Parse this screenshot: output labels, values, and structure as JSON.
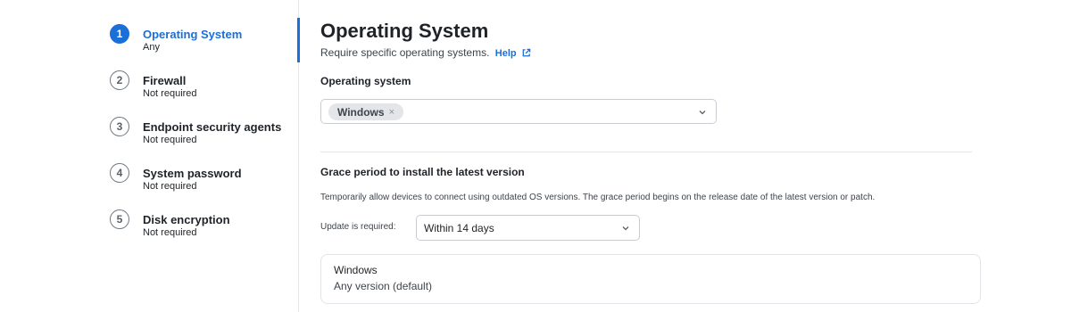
{
  "stepper": {
    "steps": [
      {
        "num": "1",
        "title": "Operating System",
        "subtitle": "Any"
      },
      {
        "num": "2",
        "title": "Firewall",
        "subtitle": "Not required"
      },
      {
        "num": "3",
        "title": "Endpoint security agents",
        "subtitle": "Not required"
      },
      {
        "num": "4",
        "title": "System password",
        "subtitle": "Not required"
      },
      {
        "num": "5",
        "title": "Disk encryption",
        "subtitle": "Not required"
      }
    ],
    "active_index": 0
  },
  "main": {
    "title": "Operating System",
    "description": "Require specific operating systems.",
    "help_label": "Help",
    "os_field": {
      "label": "Operating system",
      "selected_chips": [
        "Windows"
      ],
      "chip_remove_glyph": "×"
    },
    "grace": {
      "heading": "Grace period to install the latest version",
      "description": "Temporarily allow devices to connect using outdated OS versions. The grace period begins on the release date of the latest version or patch.",
      "update_label": "Update is required:",
      "update_value": "Within 14 days"
    },
    "card": {
      "title": "Windows",
      "subtitle": "Any version (default)"
    }
  },
  "colors": {
    "accent": "#1a6fd8",
    "text": "#1f2328",
    "muted": "#3d444d",
    "border": "#c9cdd2",
    "chip_bg": "#e3e5e8"
  },
  "icons": {
    "help": "external-link-icon",
    "dropdown": "chevron-down-icon",
    "chip_remove": "close-icon"
  }
}
